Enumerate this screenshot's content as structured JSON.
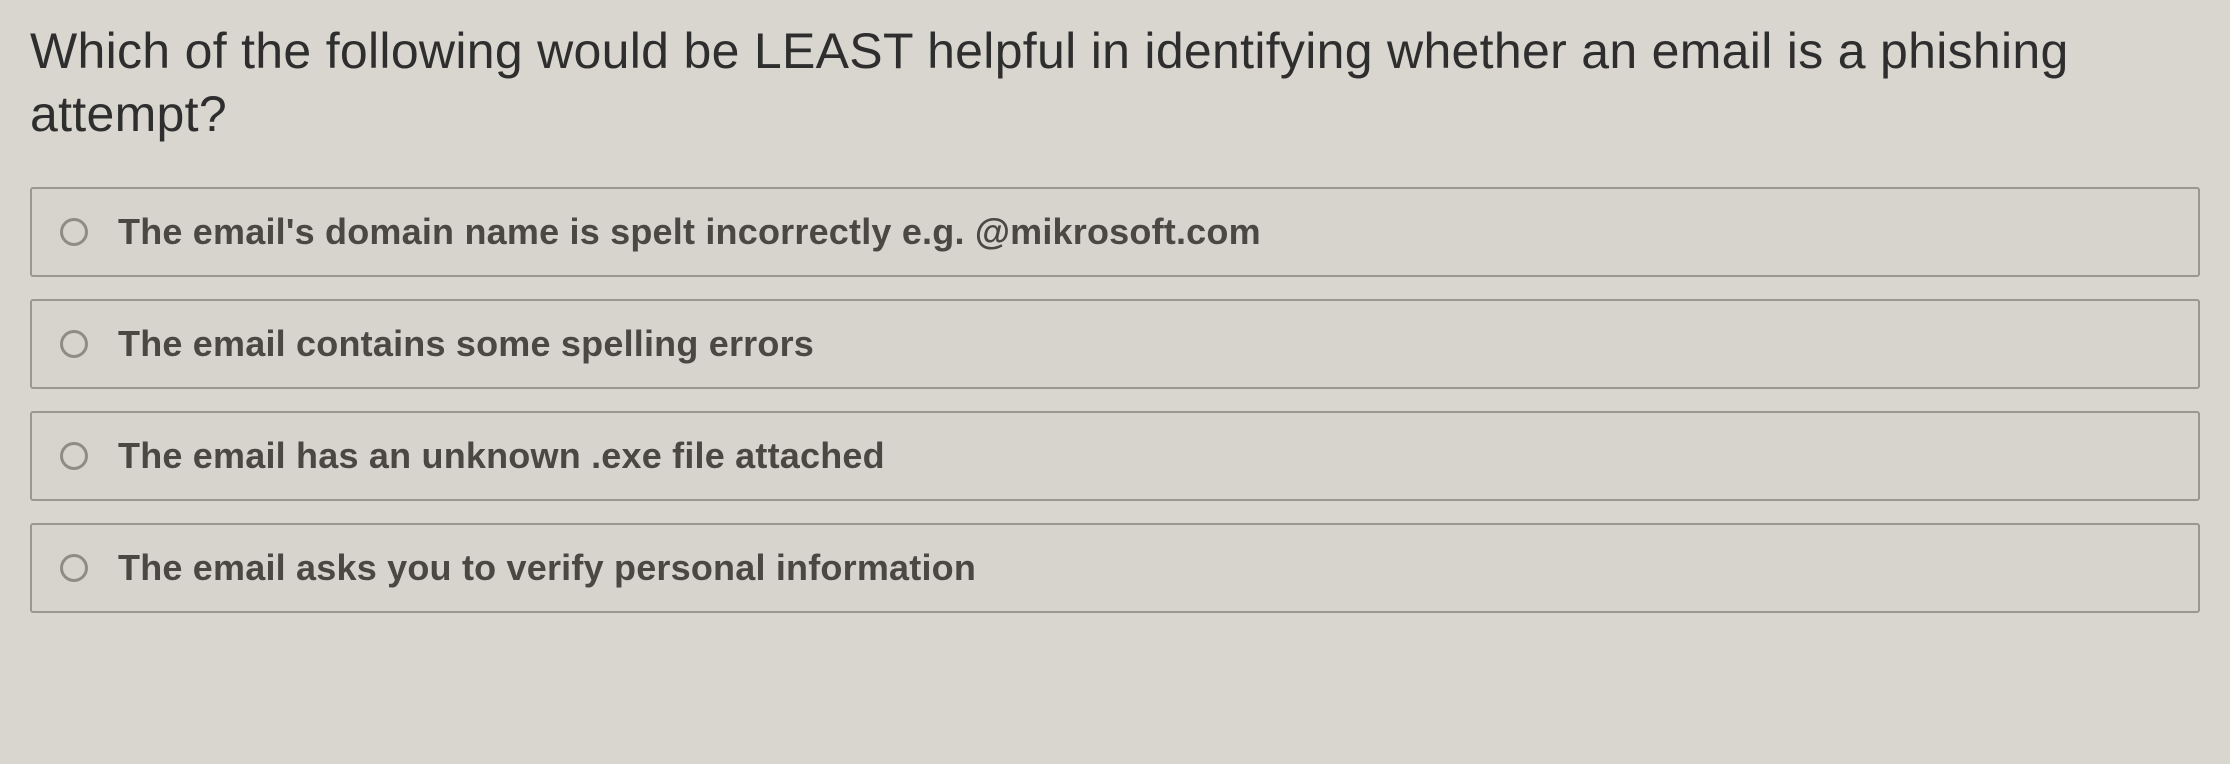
{
  "question": {
    "text": "Which of the following would be LEAST helpful in identifying whether an email is a phishing attempt?"
  },
  "options": [
    {
      "label": "The email's domain name is spelt incorrectly e.g. @mikrosoft.com"
    },
    {
      "label": "The email contains some spelling errors"
    },
    {
      "label": "The email has an unknown .exe file attached"
    },
    {
      "label": "The email asks you to verify personal information"
    }
  ]
}
